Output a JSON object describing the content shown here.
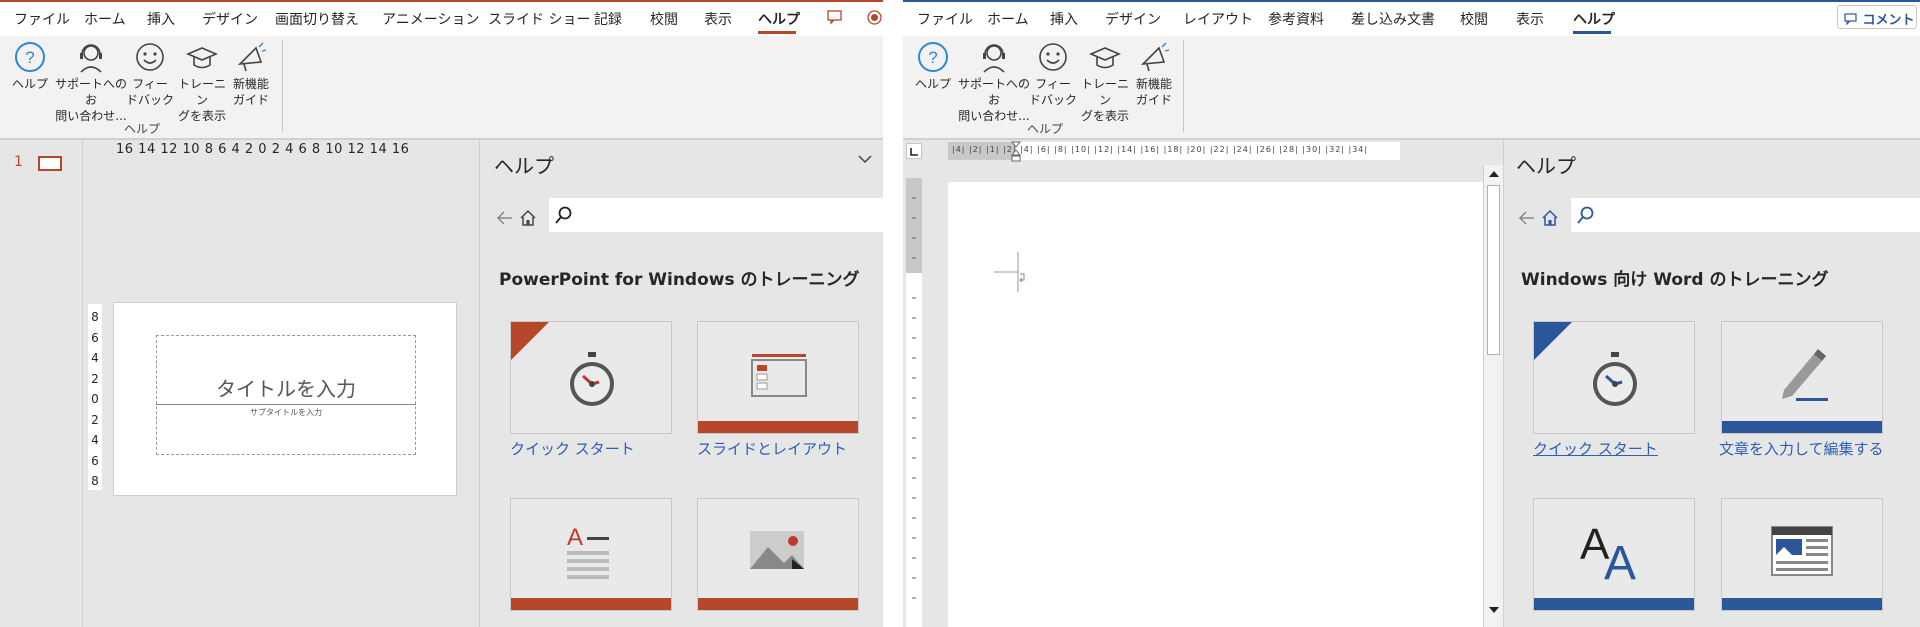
{
  "powerpoint": {
    "tabs": [
      "ファイル",
      "ホーム",
      "挿入",
      "デザイン",
      "画面切り替え",
      "アニメーション",
      "スライド ショー",
      "記録",
      "校閲",
      "表示",
      "ヘルプ"
    ],
    "active_tab": "ヘルプ",
    "ribbon_buttons": [
      {
        "line1": "ヘルプ",
        "line2": "",
        "icon": "help-circle-icon"
      },
      {
        "line1": "サポートへのお",
        "line2": "問い合わせ...",
        "icon": "headset-icon"
      },
      {
        "line1": "フィー",
        "line2": "ドバック",
        "icon": "smiley-icon"
      },
      {
        "line1": "トレーニン",
        "line2": "グを表示",
        "icon": "graduation-cap-icon"
      },
      {
        "line1": "新機能",
        "line2": "ガイド",
        "icon": "megaphone-icon"
      }
    ],
    "ribbon_group": "ヘルプ",
    "slide_number": "1",
    "ruler_numbers": "16 14 12 10 8 6 4 2 0 2 4 6 8 10 12 14 16",
    "vertical_ruler": [
      "8",
      "6",
      "4",
      "2",
      "0",
      "2",
      "4",
      "6",
      "8"
    ],
    "slide_title_placeholder": "タイトルを入力",
    "slide_subtitle_placeholder": "サブタイトルを入力",
    "help_pane": {
      "title": "ヘルプ",
      "heading": "PowerPoint for Windows のトレーニング",
      "cards": [
        {
          "label": "クイック スタート",
          "icon": "stopwatch-icon"
        },
        {
          "label": "スライドとレイアウト",
          "icon": "slide-layout-icon"
        },
        {
          "label": "",
          "icon": "text-format-icon"
        },
        {
          "label": "",
          "icon": "picture-icon"
        }
      ]
    },
    "accent": "#b7472a"
  },
  "word": {
    "tabs": [
      "ファイル",
      "ホーム",
      "挿入",
      "デザイン",
      "レイアウト",
      "参考資料",
      "差し込み文書",
      "校閲",
      "表示",
      "ヘルプ"
    ],
    "active_tab": "ヘルプ",
    "comment_button": "コメント",
    "ribbon_buttons": [
      {
        "line1": "ヘルプ",
        "line2": "",
        "icon": "help-circle-icon"
      },
      {
        "line1": "サポートへのお",
        "line2": "問い合わせ...",
        "icon": "headset-icon"
      },
      {
        "line1": "フィー",
        "line2": "ドバック",
        "icon": "smiley-icon"
      },
      {
        "line1": "トレーニン",
        "line2": "グを表示",
        "icon": "graduation-cap-icon"
      },
      {
        "line1": "新機能",
        "line2": "ガイド",
        "icon": "megaphone-icon"
      }
    ],
    "ribbon_group": "ヘルプ",
    "ruler_numbers": "|4| |2| |1| |2| |4| |6| |8| |10| |12| |14| |16| |18| |20| |22| |24| |26| |28| |30| |32| |34|",
    "help_pane": {
      "title": "ヘルプ",
      "heading": "Windows 向け Word のトレーニング",
      "cards": [
        {
          "label": "クイック スタート",
          "icon": "stopwatch-icon"
        },
        {
          "label": "文章を入力して編集する",
          "icon": "pencil-icon"
        },
        {
          "label": "",
          "icon": "font-icon"
        },
        {
          "label": "",
          "icon": "table-image-icon"
        }
      ]
    },
    "accent": "#2b579a"
  }
}
